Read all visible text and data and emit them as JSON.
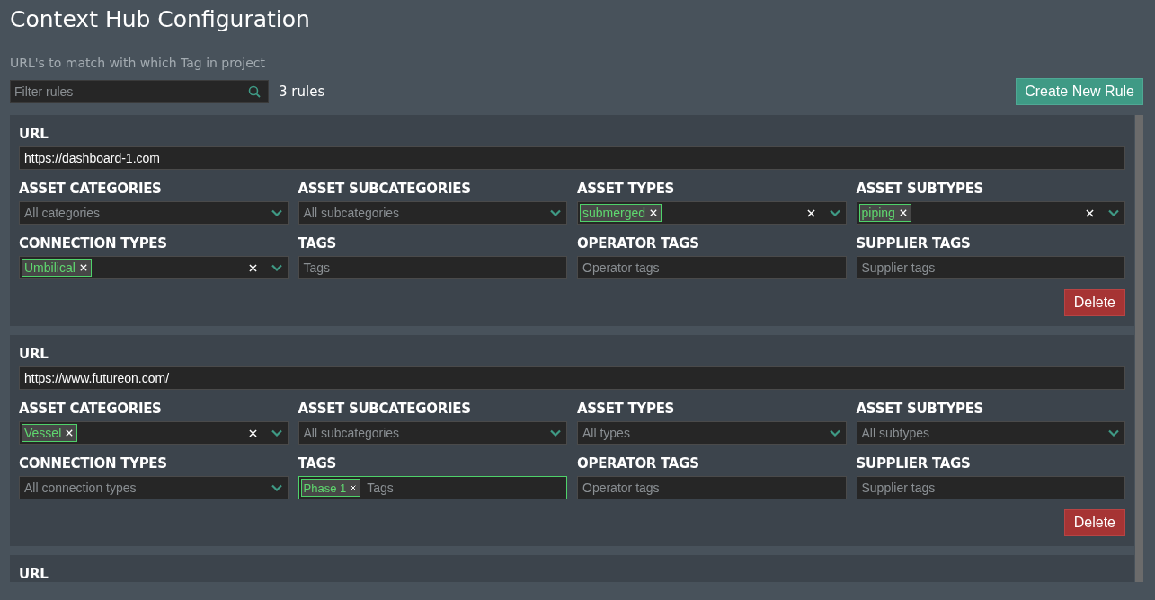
{
  "page": {
    "title": "Context Hub Configuration",
    "subtitle": "URL's to match with which Tag in project"
  },
  "toolbar": {
    "filter": {
      "placeholder": "Filter rules"
    },
    "count": "3 rules",
    "create_button": "Create New Rule"
  },
  "rules": [
    {
      "url_label": "URL",
      "url": "https://dashboard-1.com",
      "fields": [
        {
          "label": "ASSET CATEGORIES",
          "kind": "select",
          "placeholder": "All categories"
        },
        {
          "label": "ASSET SUBCATEGORIES",
          "kind": "select",
          "placeholder": "All subcategories"
        },
        {
          "label": "ASSET TYPES",
          "kind": "select",
          "chips": [
            "submerged"
          ]
        },
        {
          "label": "ASSET SUBTYPES",
          "kind": "select",
          "chips": [
            "piping"
          ]
        },
        {
          "label": "CONNECTION TYPES",
          "kind": "select",
          "chips": [
            "Umbilical"
          ]
        },
        {
          "label": "TAGS",
          "kind": "tags",
          "placeholder": "Tags",
          "focused": false
        },
        {
          "label": "OPERATOR TAGS",
          "kind": "tags",
          "placeholder": "Operator tags",
          "focused": false
        },
        {
          "label": "SUPPLIER TAGS",
          "kind": "tags",
          "placeholder": "Supplier tags",
          "focused": false
        }
      ],
      "delete_button": "Delete"
    },
    {
      "url_label": "URL",
      "url": "https://www.futureon.com/",
      "fields": [
        {
          "label": "ASSET CATEGORIES",
          "kind": "select",
          "chips": [
            "Vessel"
          ]
        },
        {
          "label": "ASSET SUBCATEGORIES",
          "kind": "select",
          "placeholder": "All subcategories"
        },
        {
          "label": "ASSET TYPES",
          "kind": "select",
          "placeholder": "All types"
        },
        {
          "label": "ASSET SUBTYPES",
          "kind": "select",
          "placeholder": "All subtypes"
        },
        {
          "label": "CONNECTION TYPES",
          "kind": "select",
          "placeholder": "All connection types"
        },
        {
          "label": "TAGS",
          "kind": "tags",
          "placeholder": "Tags",
          "chips": [
            "Phase 1"
          ],
          "focused": true
        },
        {
          "label": "OPERATOR TAGS",
          "kind": "tags",
          "placeholder": "Operator tags",
          "focused": false
        },
        {
          "label": "SUPPLIER TAGS",
          "kind": "tags",
          "placeholder": "Supplier tags",
          "focused": false
        }
      ],
      "delete_button": "Delete"
    },
    {
      "url_label": "URL"
    }
  ]
}
